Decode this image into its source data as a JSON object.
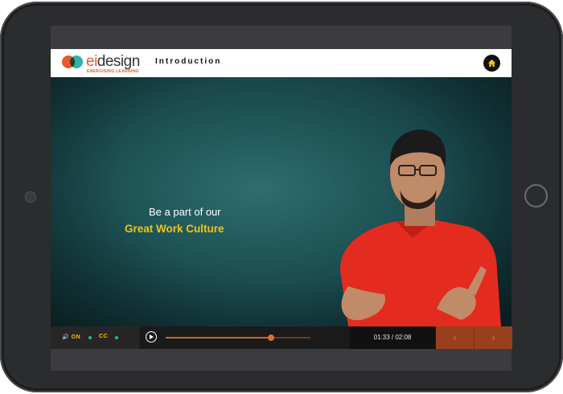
{
  "brand": {
    "name_ei": "ei",
    "name_rest": "design",
    "tagline": "ENERGISING LEARNING",
    "orange": "#e9582c",
    "teal": "#2fb1ac"
  },
  "header": {
    "title": "Introduction",
    "home_icon": "home-icon"
  },
  "video": {
    "caption_line1": "Be a part of our",
    "caption_line2": "Great Work Culture"
  },
  "controls": {
    "volume_label": "ON",
    "cc_label": "CC",
    "time": "01:33 / 02:08",
    "progress": 0.73,
    "prev_symbol": "‹",
    "next_symbol": "›"
  }
}
